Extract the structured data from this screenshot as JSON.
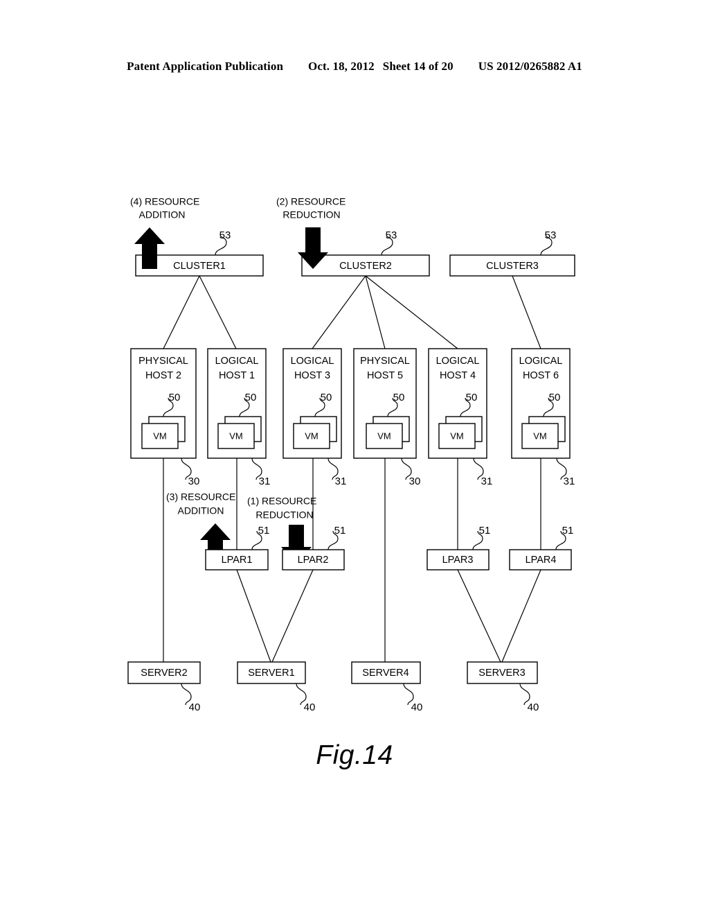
{
  "header": {
    "publication": "Patent Application Publication",
    "date": "Oct. 18, 2012",
    "sheet": "Sheet 14 of 20",
    "number": "US 2012/0265882 A1"
  },
  "figure": {
    "caption": "Fig.14",
    "clusters": [
      {
        "label": "CLUSTER1",
        "ref": "53"
      },
      {
        "label": "CLUSTER2",
        "ref": "53"
      },
      {
        "label": "CLUSTER3",
        "ref": "53"
      }
    ],
    "hosts": [
      {
        "line1": "PHYSICAL",
        "line2": "HOST 2",
        "vm_label": "VM",
        "vm_ref": "50",
        "ref": "30"
      },
      {
        "line1": "LOGICAL",
        "line2": "HOST 1",
        "vm_label": "VM",
        "vm_ref": "50",
        "ref": "31"
      },
      {
        "line1": "LOGICAL",
        "line2": "HOST 3",
        "vm_label": "VM",
        "vm_ref": "50",
        "ref": "31"
      },
      {
        "line1": "PHYSICAL",
        "line2": "HOST 5",
        "vm_label": "VM",
        "vm_ref": "50",
        "ref": "30"
      },
      {
        "line1": "LOGICAL",
        "line2": "HOST 4",
        "vm_label": "VM",
        "vm_ref": "50",
        "ref": "31"
      },
      {
        "line1": "LOGICAL",
        "line2": "HOST 6",
        "vm_label": "VM",
        "vm_ref": "50",
        "ref": "31"
      }
    ],
    "lpars": [
      {
        "label": "LPAR1",
        "ref": "51"
      },
      {
        "label": "LPAR2",
        "ref": "51"
      },
      {
        "label": "LPAR3",
        "ref": "51"
      },
      {
        "label": "LPAR4",
        "ref": "51"
      }
    ],
    "servers": [
      {
        "label": "SERVER2",
        "ref": "40"
      },
      {
        "label": "SERVER1",
        "ref": "40"
      },
      {
        "label": "SERVER4",
        "ref": "40"
      },
      {
        "label": "SERVER3",
        "ref": "40"
      }
    ],
    "annotations": [
      {
        "id": "a4",
        "line1": "(4) RESOURCE",
        "line2": "ADDITION",
        "direction": "up"
      },
      {
        "id": "a2",
        "line1": "(2) RESOURCE",
        "line2": "REDUCTION",
        "direction": "down"
      },
      {
        "id": "a3",
        "line1": "(3) RESOURCE",
        "line2": "ADDITION",
        "direction": "up"
      },
      {
        "id": "a1",
        "line1": "(1)  RESOURCE",
        "line2": "REDUCTION",
        "direction": "down"
      }
    ]
  }
}
